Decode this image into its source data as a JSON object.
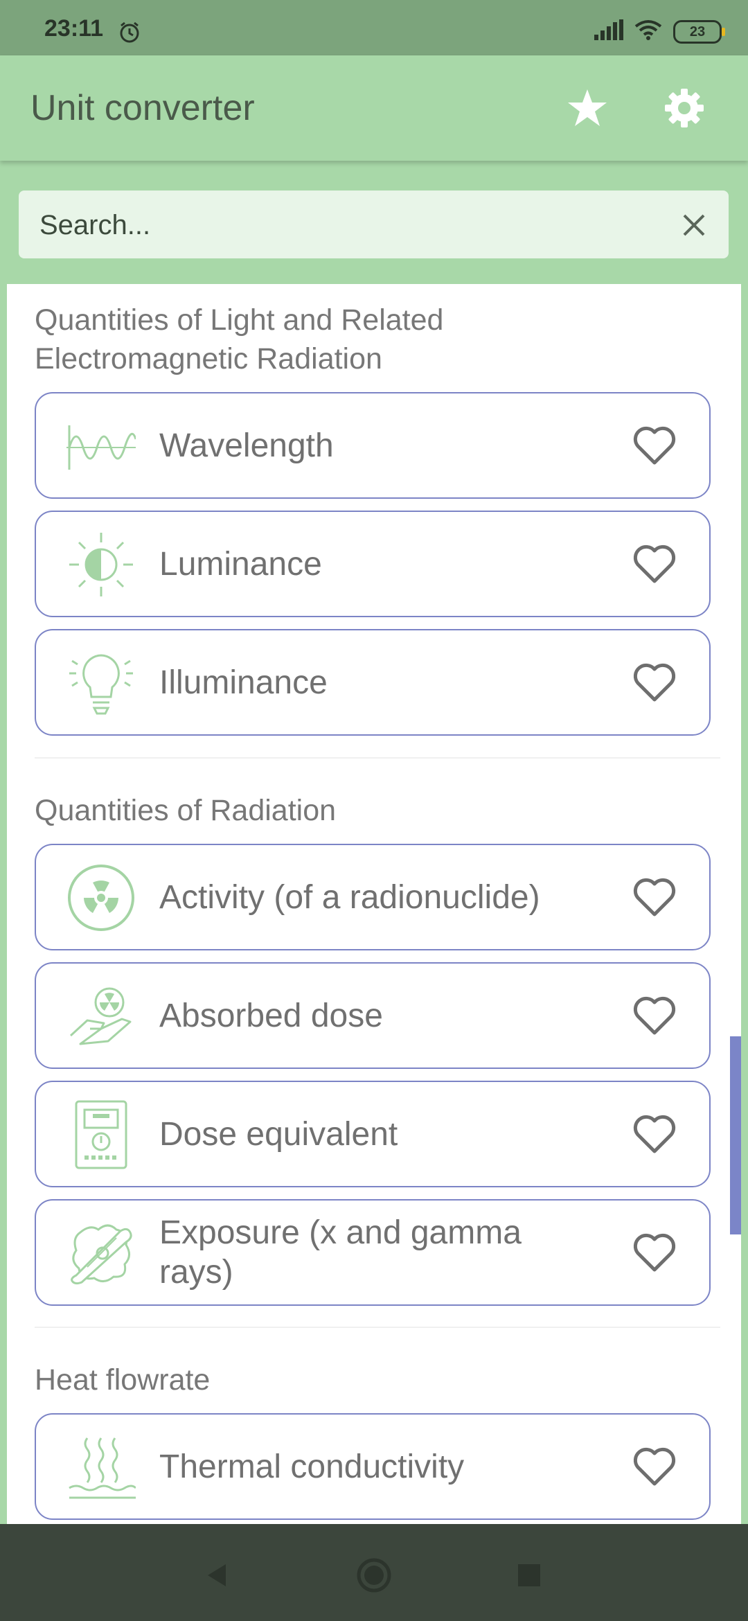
{
  "status": {
    "time": "23:11",
    "battery": "23"
  },
  "app": {
    "title": "Unit converter",
    "favorites_icon": "star-icon",
    "settings_icon": "gear-icon"
  },
  "search": {
    "placeholder": "Search...",
    "value": ""
  },
  "sections": [
    {
      "title": "Quantities of Light and Related Electromagnetic Radiation",
      "items": [
        {
          "label": "Wavelength",
          "icon": "wavelength-icon"
        },
        {
          "label": "Luminance",
          "icon": "luminance-icon"
        },
        {
          "label": "Illuminance",
          "icon": "lightbulb-icon"
        }
      ]
    },
    {
      "title": "Quantities of Radiation",
      "items": [
        {
          "label": "Activity (of a radionuclide)",
          "icon": "radiation-icon"
        },
        {
          "label": "Absorbed dose",
          "icon": "hand-radiation-icon"
        },
        {
          "label": "Dose equivalent",
          "icon": "dosimeter-icon"
        },
        {
          "label": "Exposure (x and gamma rays)",
          "icon": "xray-icon"
        }
      ]
    },
    {
      "title": "Heat flowrate",
      "items": [
        {
          "label": "Thermal conductivity",
          "icon": "heat-waves-icon"
        }
      ]
    }
  ],
  "colors": {
    "accent": "#a8d8a8",
    "icon_green": "#a4d4a4",
    "card_border": "#7c84c6",
    "nav_bar": "#3c463c"
  }
}
